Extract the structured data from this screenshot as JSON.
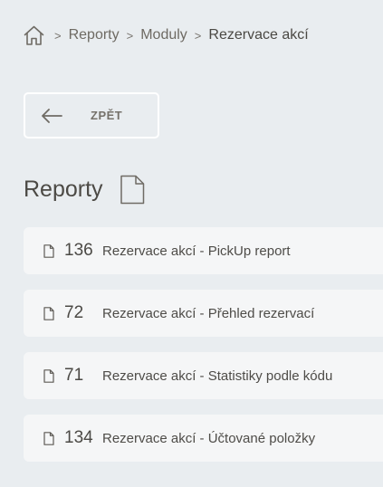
{
  "breadcrumb": {
    "home_icon": "home-icon",
    "separator": ">",
    "items": [
      "Reporty",
      "Moduly",
      "Rezervace akcí"
    ]
  },
  "back_button": {
    "icon": "arrow-left-icon",
    "label": "ZPĚT"
  },
  "section": {
    "title": "Reporty",
    "icon": "document-icon"
  },
  "reports": [
    {
      "id": "136",
      "name": "Rezervace akcí - PickUp report"
    },
    {
      "id": "72",
      "name": "Rezervace akcí - Přehled rezervací"
    },
    {
      "id": "71",
      "name": "Rezervace akcí - Statistiky podle kódu"
    },
    {
      "id": "134",
      "name": "Rezervace akcí - Účtované položky"
    }
  ],
  "colors": {
    "background": "#e9edf0",
    "card": "#f5f6f7",
    "text": "#4f4d49",
    "muted": "#75716a"
  }
}
